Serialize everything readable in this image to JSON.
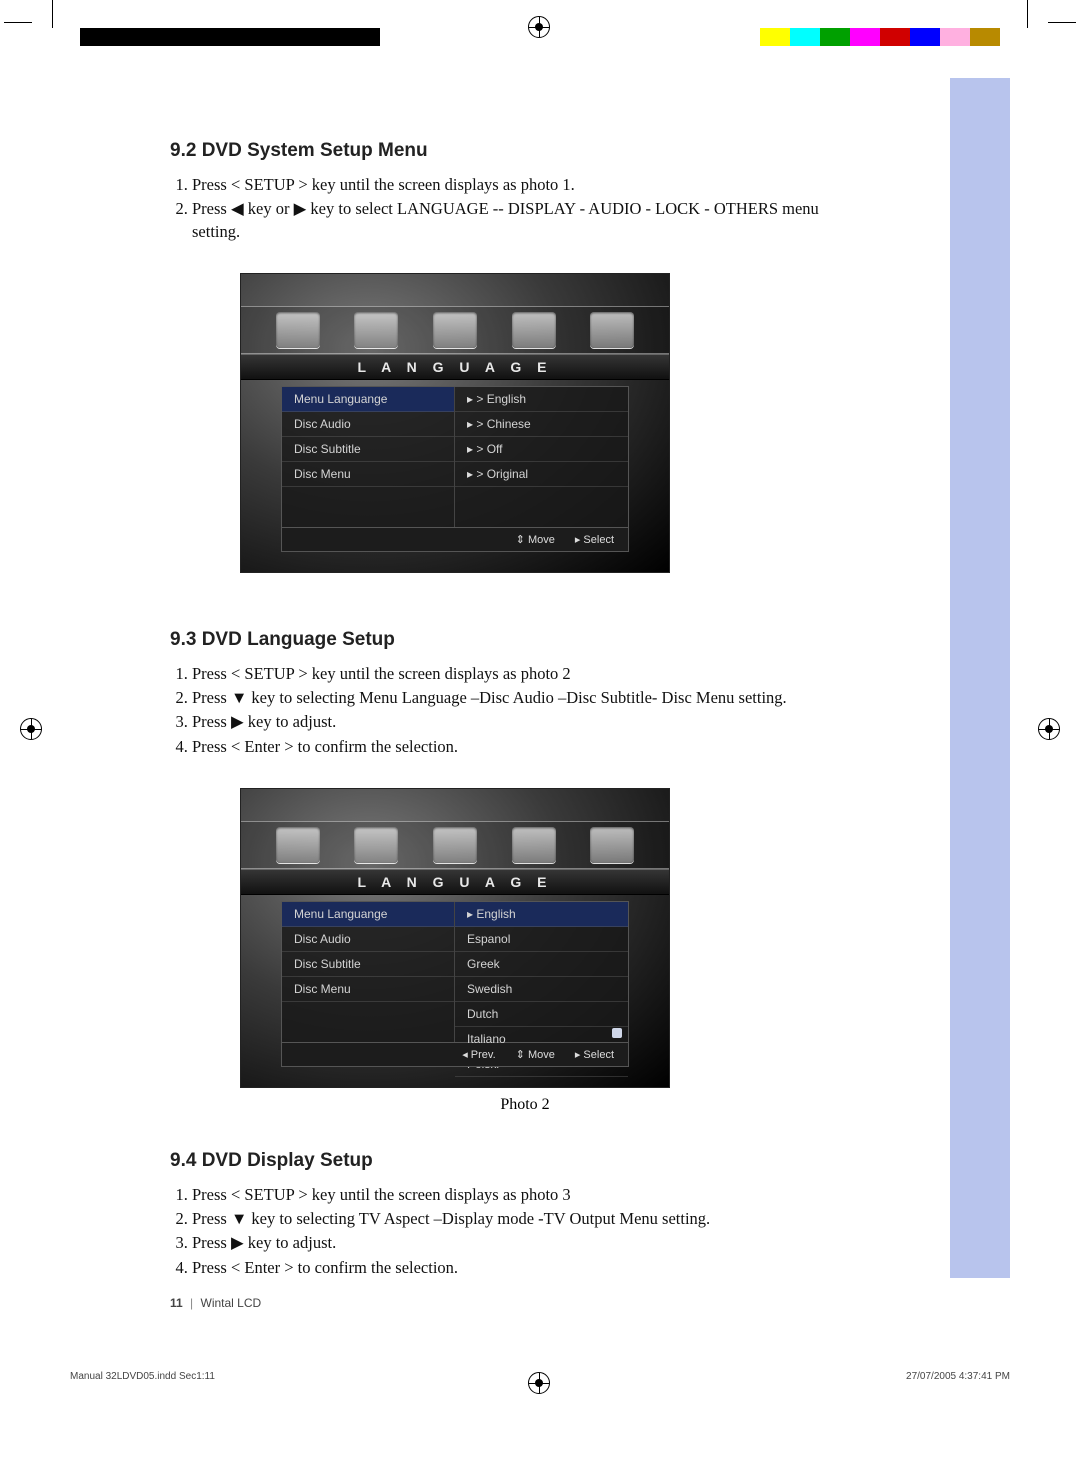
{
  "sections": {
    "s92": {
      "heading": "9.2 DVD System Setup Menu",
      "steps": [
        "Press < SETUP > key until the screen displays as photo 1.",
        "Press ◀ key or ▶ key to select LANGUAGE -- DISPLAY - AUDIO - LOCK - OTHERS menu setting."
      ]
    },
    "s93": {
      "heading": "9.3 DVD  Language Setup",
      "steps": [
        "Press < SETUP > key until the screen displays as photo 2",
        "Press ▼ key to selecting Menu Language –Disc Audio –Disc Subtitle- Disc Menu setting.",
        "Press ▶ key to adjust.",
        "Press < Enter > to confirm the selection."
      ]
    },
    "s94": {
      "heading": "9.4 DVD Display Setup",
      "steps": [
        "Press < SETUP > key until the screen displays as photo 3",
        "Press ▼ key to selecting TV Aspect –Display mode -TV Output Menu setting.",
        "Press ▶ key to adjust.",
        "Press < Enter > to confirm the selection."
      ]
    }
  },
  "osd1": {
    "title": "L A N G U A G E",
    "left": [
      "Menu Languange",
      "Disc Audio",
      "Disc Subtitle",
      "Disc Menu"
    ],
    "right": [
      "English",
      "Chinese",
      "Off",
      "Original"
    ],
    "foot": [
      "⇕ Move",
      "▸ Select"
    ]
  },
  "osd2": {
    "title": "L A N G U A G E",
    "left": [
      "Menu Languange",
      "Disc Audio",
      "Disc Subtitle",
      "Disc Menu"
    ],
    "right": [
      "English",
      "Espanol",
      "Greek",
      "Swedish",
      "Dutch",
      "Italiano",
      "Polski"
    ],
    "foot": [
      "◂ Prev.",
      "⇕ Move",
      "▸ Select"
    ],
    "caption": "Photo 2"
  },
  "footer": {
    "page": "11",
    "doc": "Wintal LCD"
  },
  "printMeta": {
    "file": "Manual 32LDVD05.indd   Sec1:11",
    "date": "27/07/2005   4:37:41 PM"
  },
  "colorbars": {
    "right": [
      "#ffff00",
      "#00ffff",
      "#00a000",
      "#ff00ff",
      "#d00000",
      "#0000ff",
      "#ffb0e0",
      "#b88a00"
    ]
  }
}
